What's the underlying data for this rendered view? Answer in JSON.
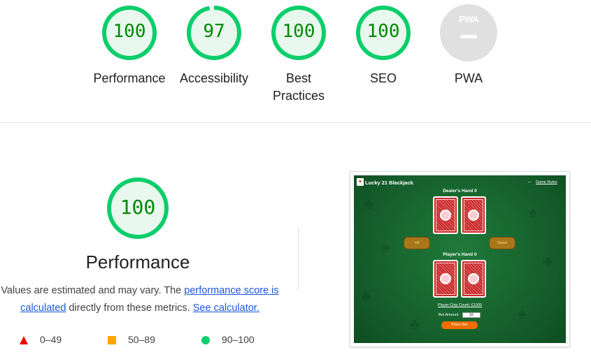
{
  "summary": {
    "categories": [
      {
        "label": "Performance",
        "score": "100",
        "score_value": 100
      },
      {
        "label": "Accessibility",
        "score": "97",
        "score_value": 97
      },
      {
        "label": "Best Practices",
        "score": "100",
        "score_value": 100
      },
      {
        "label": "SEO",
        "score": "100",
        "score_value": 100
      },
      {
        "label": "PWA",
        "badge_text": "PWA"
      }
    ]
  },
  "performance": {
    "score": "100",
    "score_value": 100,
    "title": "Performance",
    "description": {
      "text_1": "Values are estimated and may vary. The ",
      "link_1": "performance score is calculated",
      "text_2": " directly from these metrics. ",
      "link_2": "See calculator."
    },
    "legend": [
      {
        "range": "0–49",
        "color": "#eb0f00",
        "shape": "triangle"
      },
      {
        "range": "50–89",
        "color": "#ffa400",
        "shape": "square"
      },
      {
        "range": "90–100",
        "color": "#0cce6b",
        "shape": "circle"
      }
    ]
  },
  "screenshot": {
    "app_title": "Lucky 21 Blackjack",
    "rules_link": "Game Rules",
    "dealer_label": "Dealer's Hand",
    "dealer_total": "0",
    "player_label": "Player's Hand",
    "player_total": "0",
    "hit_button": "Hit",
    "stand_button": "Stand",
    "chip_count": "Player Chip Count: €1000",
    "bet_label": "Bet Amount",
    "bet_value": "10",
    "place_bet_button": "Place Bet"
  },
  "colors": {
    "pass": "#0cce6b",
    "pass_text": "#008800",
    "pass_fill": "#e8f8ee",
    "average": "#ffa400",
    "fail": "#eb0f00",
    "disabled": "#e0e0e0",
    "link": "#1a56db"
  }
}
